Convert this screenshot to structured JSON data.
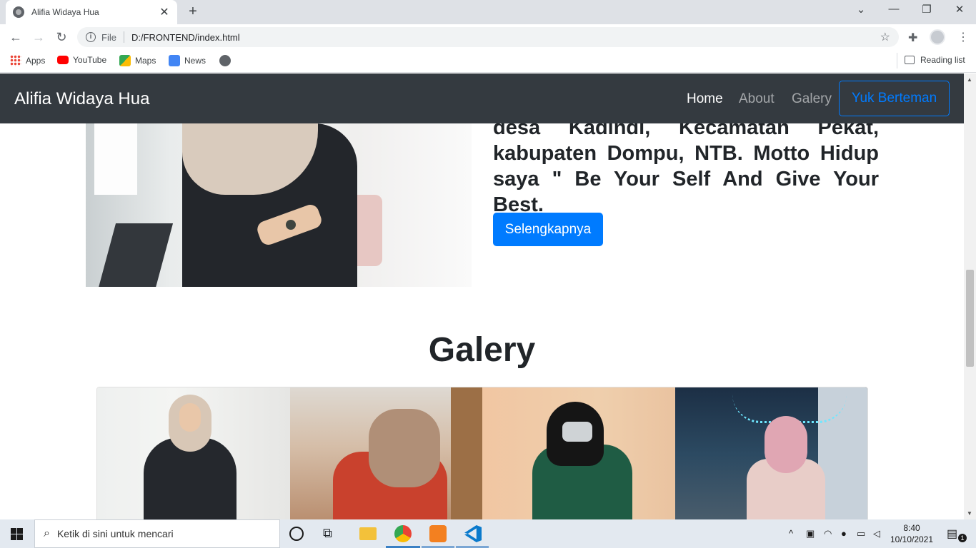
{
  "browser": {
    "tab_title": "Alifia Widaya Hua",
    "tab_close": "✕",
    "new_tab": "+",
    "url_scheme_label": "File",
    "url": "D:/FRONTEND/index.html",
    "bookmarks": [
      "Apps",
      "YouTube",
      "Maps",
      "News"
    ],
    "reading_list": "Reading list",
    "window_controls": [
      "⌄",
      "—",
      "❐",
      "✕"
    ]
  },
  "page": {
    "brand": "Alifia Widaya Hua",
    "nav": [
      "Home",
      "About",
      "Galery"
    ],
    "nav_cta": "Yuk Berteman",
    "about_text": "desa Kadindi, Kecamatan Pekat, kabupaten Dompu, NTB. Motto Hidup saya \" Be Your Self And Give Your Best.",
    "more_button": "Selengkapnya",
    "gallery_title": "Galery"
  },
  "taskbar": {
    "search_placeholder": "Ketik di sini untuk mencari",
    "time": "8:40",
    "date": "10/10/2021",
    "notifications": "1"
  },
  "colors": {
    "navbar_bg": "#343a40",
    "primary": "#007bff",
    "taskbar_bg": "#e3e9f0"
  }
}
